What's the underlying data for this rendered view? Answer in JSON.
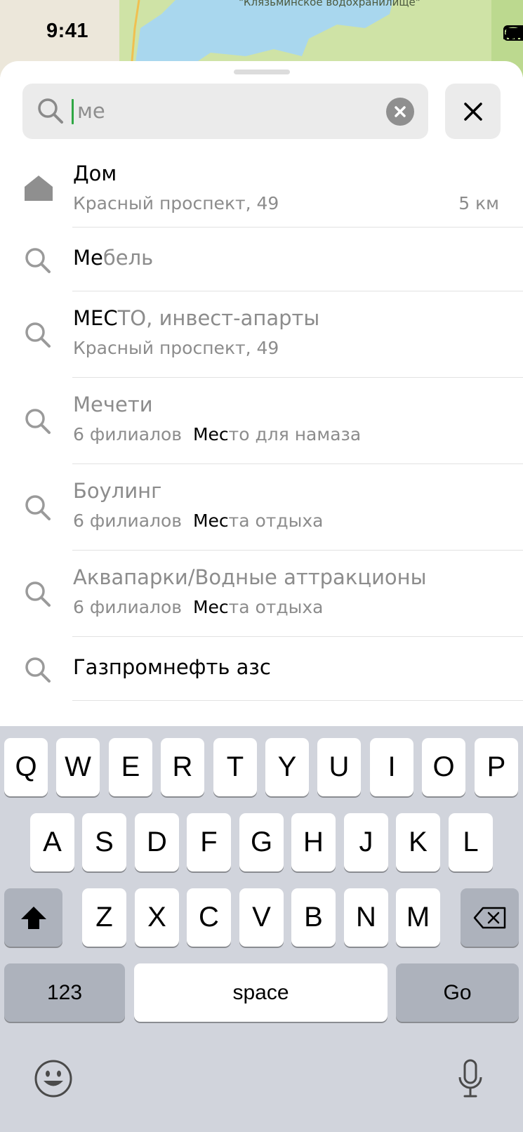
{
  "map": {
    "label": "\"Клязьминское водохранилище\""
  },
  "status_bar": {
    "time": "9:41"
  },
  "search": {
    "query": "ме",
    "placeholder": ""
  },
  "results": [
    {
      "type": "home",
      "title_bold": "Дом",
      "title_rest": "",
      "subtitle_prefix": "",
      "subtitle_bold": "",
      "subtitle": "Красный проспект, 49",
      "distance": "5 км"
    },
    {
      "type": "search",
      "title_bold": "Ме",
      "title_rest": "бель",
      "subtitle_prefix": "",
      "subtitle_bold": "",
      "subtitle": "",
      "distance": ""
    },
    {
      "type": "search",
      "title_bold": "МЕС",
      "title_rest": "ТО, инвест-апарты",
      "subtitle_prefix": "",
      "subtitle_bold": "",
      "subtitle": "Красный проспект, 49",
      "distance": ""
    },
    {
      "type": "search",
      "title_bold": "",
      "title_rest": "Мечети",
      "subtitle_prefix": "6 филиалов",
      "subtitle_bold": "Мес",
      "subtitle": "то для намаза",
      "distance": ""
    },
    {
      "type": "search",
      "title_bold": "",
      "title_rest": "Боулинг",
      "subtitle_prefix": "6 филиалов",
      "subtitle_bold": "Мес",
      "subtitle": "та отдыха",
      "distance": ""
    },
    {
      "type": "search",
      "title_bold": "",
      "title_rest": "Аквапарки/Водные аттракционы",
      "subtitle_prefix": "6 филиалов",
      "subtitle_bold": "Мес",
      "subtitle": "та отдыха",
      "distance": ""
    },
    {
      "type": "search",
      "title_bold": "Газпромнефть азс",
      "title_rest": "",
      "subtitle_prefix": "",
      "subtitle_bold": "",
      "subtitle": "",
      "distance": ""
    }
  ],
  "keyboard": {
    "row1": [
      "Q",
      "W",
      "E",
      "R",
      "T",
      "Y",
      "U",
      "I",
      "O",
      "P"
    ],
    "row2": [
      "A",
      "S",
      "D",
      "F",
      "G",
      "H",
      "J",
      "K",
      "L"
    ],
    "row3": [
      "Z",
      "X",
      "C",
      "V",
      "B",
      "N",
      "M"
    ],
    "numbers_label": "123",
    "space_label": "space",
    "go_label": "Go"
  },
  "colors": {
    "accent_caret": "#2fa744",
    "keyboard_bg": "#d1d4dc",
    "map_green": "#cfe3a6",
    "map_water": "#a9d7ee"
  }
}
